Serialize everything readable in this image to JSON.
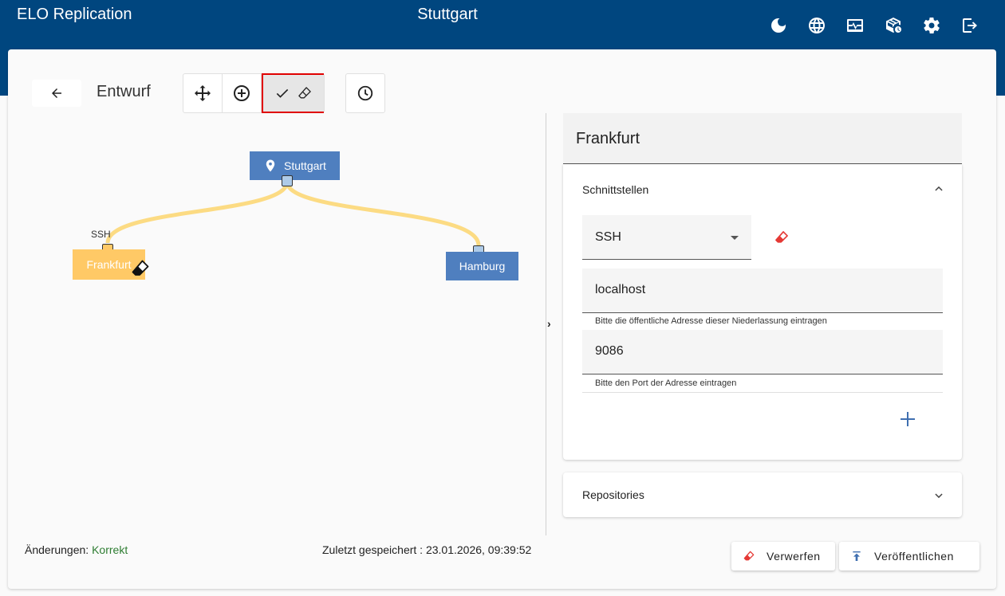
{
  "header": {
    "app_title": "ELO Replication",
    "location_title": "Stuttgart",
    "icons": [
      "moon-icon",
      "globe-icon",
      "monitor-heartbeat-icon",
      "package-clock-icon",
      "gear-icon",
      "logout-icon"
    ]
  },
  "toolbar": {
    "mode_label": "Entwurf"
  },
  "graph": {
    "nodes": {
      "stuttgart": "Stuttgart",
      "frankfurt": "Frankfurt",
      "hamburg": "Hamburg"
    },
    "edge_label": "SSH",
    "edge_color": "#fcdb83"
  },
  "panel": {
    "title": "Frankfurt",
    "interfaces": {
      "title": "Schnittstellen",
      "protocol": "SSH",
      "address_value": "localhost",
      "address_hint": "Bitte die öffentliche Adresse dieser Niederlassung eintragen",
      "port_value": "9086",
      "port_hint": "Bitte den Port der Adresse eintragen"
    },
    "repositories": {
      "title": "Repositories"
    }
  },
  "status": {
    "changes_label": "Änderungen:",
    "changes_value": "Korrekt",
    "saved_label": "Zuletzt gespeichert : 23.01.2026, 09:39:52"
  },
  "actions": {
    "discard_label": "Verwerfen",
    "publish_label": "Veröffentlichen"
  },
  "colors": {
    "header": "#00467f",
    "node_blue": "#4f7fbf",
    "node_selected": "#ffc966",
    "ok_green": "#2e7d32",
    "highlight_red": "#e00000"
  }
}
